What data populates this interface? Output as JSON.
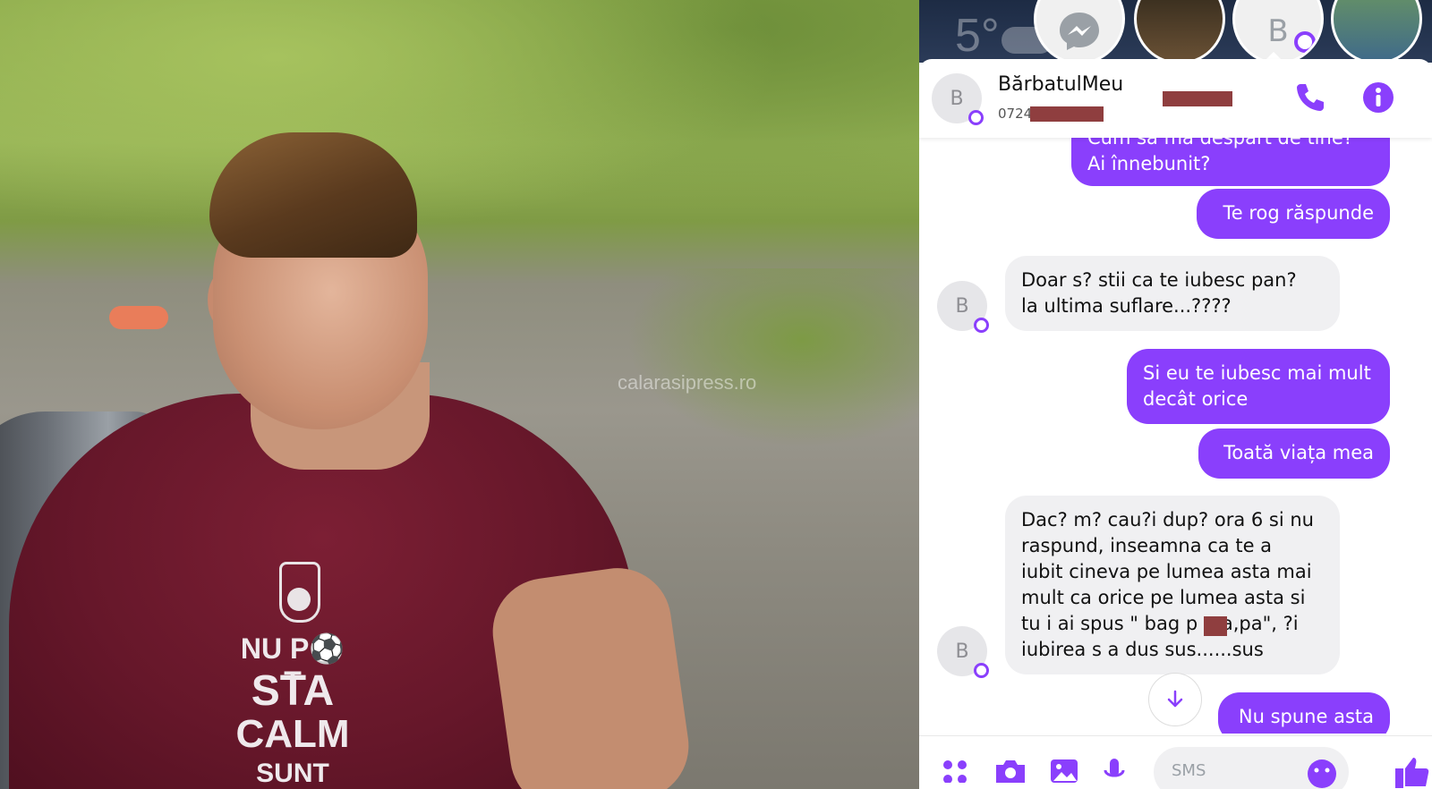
{
  "photo": {
    "shirt_lines": [
      "NU P⚽T",
      "STA",
      "CALM",
      "SUNT"
    ],
    "watermark": "calarasipress.ro"
  },
  "top_bar": {
    "weather": "5°",
    "chat_heads": [
      {
        "name": "messenger-head",
        "icon": "messenger-icon"
      },
      {
        "name": "photo-head-1",
        "icon": "avatar-photo"
      },
      {
        "name": "b-head",
        "initial": "B"
      },
      {
        "name": "photo-head-2",
        "icon": "avatar-photo"
      }
    ]
  },
  "conversation": {
    "initial": "B",
    "name": "BărbatulMeu",
    "phone_prefix": "0724",
    "accent": "#8a3ffc",
    "redaction_color": "#8f3e3f"
  },
  "messages": [
    {
      "dir": "out",
      "lines": [
        "Cum să mă despart de tine?",
        "Ai înnebunit?"
      ]
    },
    {
      "dir": "out",
      "lines": [
        "Te rog răspunde"
      ]
    },
    {
      "dir": "in",
      "lines": [
        "Doar s? stii ca te iubesc pan?",
        "la ultima suflare...????"
      ]
    },
    {
      "dir": "out",
      "lines": [
        "Si eu te iubesc mai mult",
        "decât orice"
      ]
    },
    {
      "dir": "out",
      "lines": [
        "Toată viața mea"
      ]
    },
    {
      "dir": "in",
      "lines": [
        "Dac? m? cau?i dup? ora 6 si nu",
        "raspund, inseamna ca te a",
        "iubit cineva pe lumea asta mai",
        "mult ca orice pe lumea asta si",
        "tu i ai spus \" bag p    a,pa\", ?i",
        "iubirea s a dus sus......sus"
      ]
    },
    {
      "dir": "out",
      "lines": [
        "Nu spune asta"
      ]
    }
  ],
  "composer": {
    "placeholder": "SMS",
    "icons": [
      "apps-icon",
      "camera-icon",
      "gallery-icon",
      "mic-icon",
      "emoji-icon",
      "like-icon"
    ]
  }
}
